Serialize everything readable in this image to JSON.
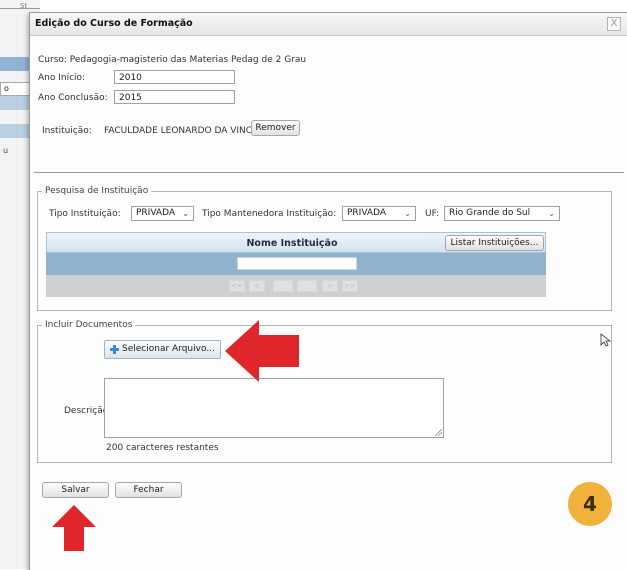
{
  "background_app": {
    "top_tab_fragment": "St",
    "tab_fragment": "o",
    "row_fragment": "u"
  },
  "dialog": {
    "title": "Edição do Curso de Formação",
    "close_glyph": "X",
    "curso_line": "Curso: Pedagogia-magisterio das Materias Pedag de 2 Grau",
    "ano_inicio_label": "Ano Início:",
    "ano_inicio_value": "2010",
    "ano_conclusao_label": "Ano Conclusão:",
    "ano_conclusao_value": "2015",
    "instituicao_label": "Instituição:",
    "instituicao_value": "FACULDADE LEONARDO DA VINCI",
    "remover_label": "Remover"
  },
  "pesquisa": {
    "legend": "Pesquisa de Instituição",
    "tipo_instituicao_label": "Tipo Instituição:",
    "tipo_instituicao_value": "PRIVADA",
    "tipo_mantenedora_label": "Tipo Mantenedora Instituição:",
    "tipo_mantenedora_value": "PRIVADA",
    "uf_label": "UF:",
    "uf_value": "Rio Grande do Sul",
    "grid_header": "Nome Instituição",
    "listar_label": "Listar Instituições...",
    "pager": [
      "<<",
      "<",
      "",
      "",
      ">",
      ">>"
    ]
  },
  "documentos": {
    "legend": "Incluir Documentos",
    "selecionar_label": "Selecionar Arquivo...",
    "descricao_label": "Descrição:",
    "remaining_text": "200 caracteres restantes"
  },
  "footer": {
    "salvar_label": "Salvar",
    "fechar_label": "Fechar"
  },
  "annotation": {
    "step_number": "4",
    "arrow_color": "#e0262b",
    "badge_color": "#f1b23c"
  }
}
